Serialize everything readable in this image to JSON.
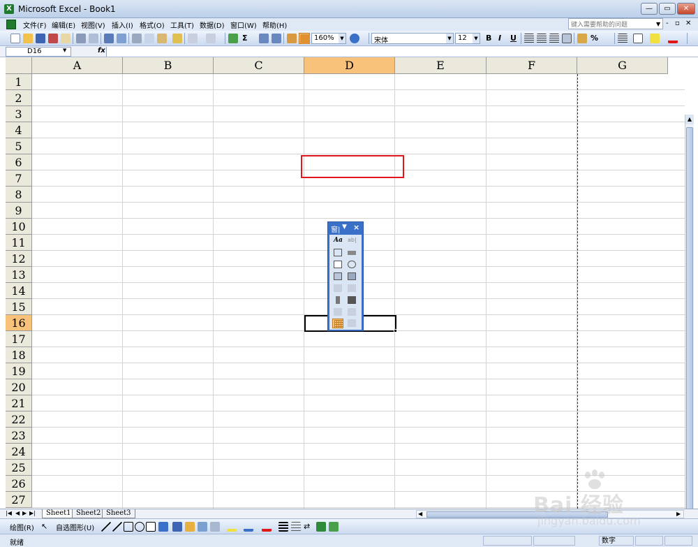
{
  "window": {
    "title": "Microsoft Excel - Book1",
    "app_icon": "X"
  },
  "menu": {
    "items": [
      "文件(F)",
      "编辑(E)",
      "视图(V)",
      "插入(I)",
      "格式(O)",
      "工具(T)",
      "数据(D)",
      "窗口(W)",
      "帮助(H)"
    ],
    "help_placeholder": "键入需要帮助的问题"
  },
  "toolbar": {
    "zoom": "160%",
    "font_name": "宋体",
    "font_size": "12",
    "bold": "B",
    "italic": "I",
    "underline": "U",
    "percent": "%"
  },
  "formula_bar": {
    "name_box": "D16",
    "fx": "fx",
    "formula": ""
  },
  "grid": {
    "columns": [
      "A",
      "B",
      "C",
      "D",
      "E",
      "F",
      "G"
    ],
    "rows": [
      "1",
      "2",
      "3",
      "4",
      "5",
      "6",
      "7",
      "8",
      "9",
      "10",
      "11",
      "12",
      "13",
      "14",
      "15",
      "16",
      "17",
      "18",
      "19",
      "20",
      "21",
      "22",
      "23",
      "24",
      "25",
      "26",
      "27"
    ],
    "active_column": "D",
    "active_row": "16"
  },
  "forms_toolbar": {
    "title": "窗|",
    "close": "×"
  },
  "sheets": {
    "tabs": [
      "Sheet1",
      "Sheet2",
      "Sheet3"
    ],
    "active": "Sheet1"
  },
  "drawing": {
    "draw_label": "绘图(R)",
    "autoshapes_label": "自选图形(U)"
  },
  "status": {
    "ready": "就绪",
    "mode": "数字"
  },
  "watermark": {
    "brand": "Bai 经验",
    "url": "jingyan.baidu.com"
  },
  "colors": {
    "accent": "#f8c27a",
    "red_highlight": "#e0161b",
    "toolbar_blue": "#3a70c8"
  }
}
